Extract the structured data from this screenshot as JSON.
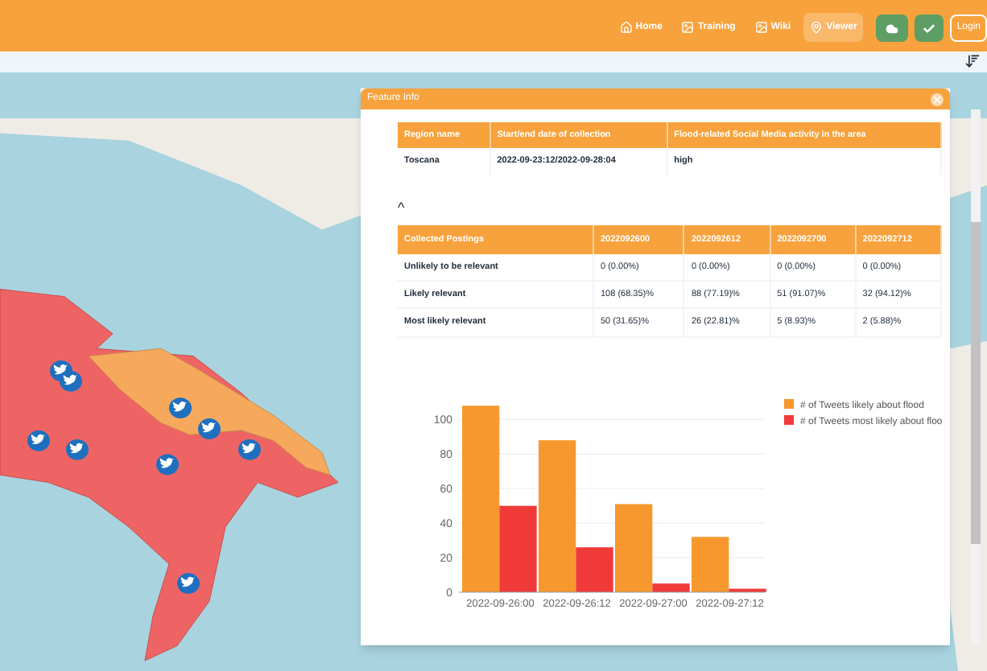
{
  "navbar": {
    "items": [
      {
        "label": "Home",
        "kind": "home",
        "selected": false
      },
      {
        "label": "Training",
        "kind": "image",
        "selected": false
      },
      {
        "label": "Wiki",
        "kind": "image",
        "selected": false
      },
      {
        "label": "Viewer",
        "kind": "pin",
        "selected": true
      }
    ],
    "login": "Login"
  },
  "popup": {
    "title": "Feature Info",
    "summary_table": {
      "columns": [
        "Region name",
        "Start/end date of collection",
        "Flood-related Social Media activity in the area"
      ],
      "rows": [
        [
          "Toscana",
          "2022-09-23:12/2022-09-28:04",
          "high"
        ]
      ]
    },
    "collapse_toggle": "^",
    "postings_table": {
      "columns": [
        "Collected Postings",
        "2022092600",
        "2022092612",
        "2022092700",
        "2022092712"
      ],
      "rows": [
        [
          "Unlikely to be relevant",
          "0 (0.00%)",
          "0 (0.00%)",
          "0 (0.00%)",
          "0 (0.00%)"
        ],
        [
          "Likely relevant",
          "108 (68.35)%",
          "88 (77.19)%",
          "51 (91.07)%",
          "32 (94.12)%"
        ],
        [
          "Most likely relevant",
          "50 (31.65)%",
          "26 (22.81)%",
          "5 (8.93)%",
          "2 (5.88)%"
        ]
      ]
    },
    "chart_data": {
      "type": "bar",
      "categories": [
        "2022-09-26:00",
        "2022-09-26:12",
        "2022-09-27:00",
        "2022-09-27:12"
      ],
      "ylim": [
        0,
        110
      ],
      "yticks": [
        0,
        20,
        40,
        60,
        80,
        100
      ],
      "grid": true,
      "legend": true,
      "series": [
        {
          "name": "# of Tweets likely about flood",
          "color": "#f7982f",
          "values": [
            108,
            88,
            51,
            32
          ]
        },
        {
          "name": "# of Tweets most likely about floo",
          "color": "#f03a3a",
          "values": [
            50,
            26,
            5,
            2
          ]
        }
      ]
    }
  }
}
